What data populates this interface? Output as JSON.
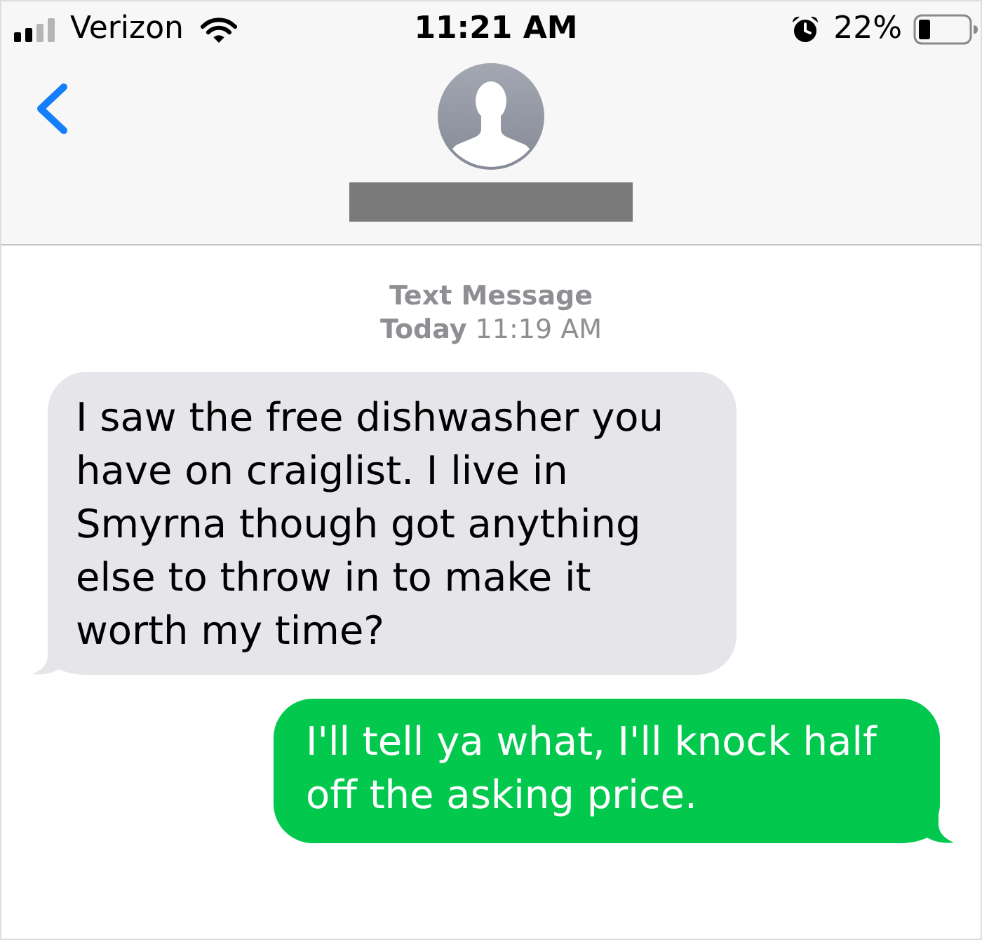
{
  "status_bar": {
    "carrier": "Verizon",
    "time": "11:21 AM",
    "battery": "22%"
  },
  "conversation": {
    "service": "Text Message",
    "timestamp": "**Today** 11:19 AM"
  },
  "messages": [
    {
      "kind": "received",
      "text": "I saw the free dishwasher you have on craiglist. I live in Smyrna though got anything else to throw in to make it worth my time?"
    },
    {
      "kind": "sent",
      "text": "I'll tell ya what, I'll knock half off the asking price."
    }
  ]
}
